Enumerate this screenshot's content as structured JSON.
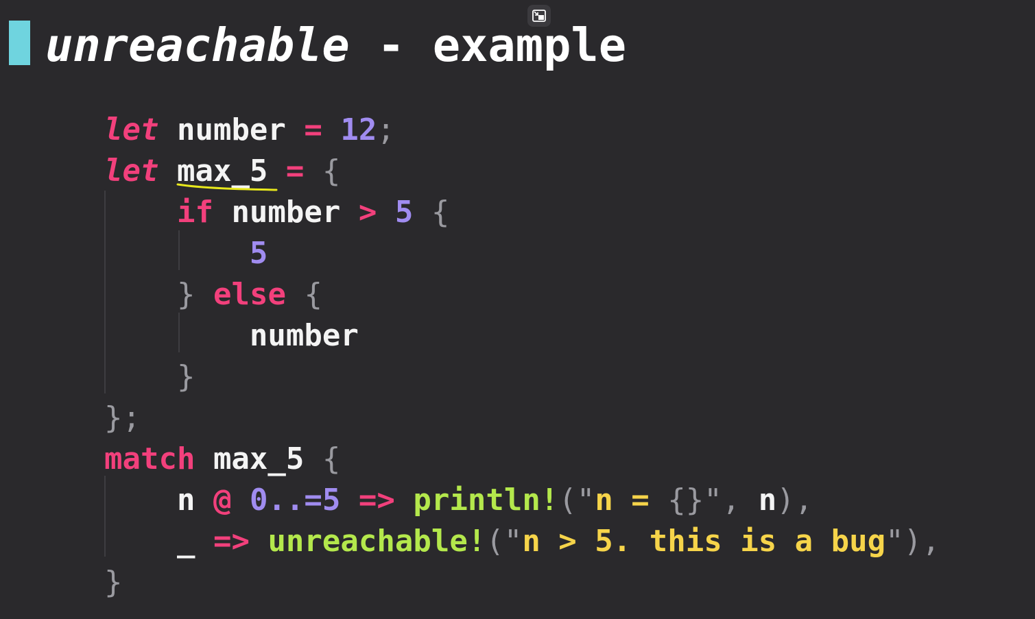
{
  "title": {
    "main": "unreachable",
    "separator": " - ",
    "rest": "example"
  },
  "code_lines": [
    [
      {
        "t": "let",
        "c": "kw-it"
      },
      {
        "t": " number ",
        "c": "ident"
      },
      {
        "t": "=",
        "c": "op"
      },
      {
        "t": " ",
        "c": "ident"
      },
      {
        "t": "12",
        "c": "num"
      },
      {
        "t": ";",
        "c": "punc"
      }
    ],
    [
      {
        "t": "let",
        "c": "kw-it"
      },
      {
        "t": " max_5 ",
        "c": "ident"
      },
      {
        "t": "=",
        "c": "op"
      },
      {
        "t": " ",
        "c": "ident"
      },
      {
        "t": "{",
        "c": "punc"
      }
    ],
    [
      {
        "t": "    ",
        "c": "ident"
      },
      {
        "t": "if",
        "c": "kw"
      },
      {
        "t": " number ",
        "c": "ident"
      },
      {
        "t": ">",
        "c": "op"
      },
      {
        "t": " ",
        "c": "ident"
      },
      {
        "t": "5",
        "c": "num"
      },
      {
        "t": " ",
        "c": "ident"
      },
      {
        "t": "{",
        "c": "punc"
      }
    ],
    [
      {
        "t": "        ",
        "c": "ident"
      },
      {
        "t": "5",
        "c": "num"
      }
    ],
    [
      {
        "t": "    ",
        "c": "ident"
      },
      {
        "t": "}",
        "c": "punc"
      },
      {
        "t": " ",
        "c": "ident"
      },
      {
        "t": "else",
        "c": "kw"
      },
      {
        "t": " ",
        "c": "ident"
      },
      {
        "t": "{",
        "c": "punc"
      }
    ],
    [
      {
        "t": "        number",
        "c": "ident"
      }
    ],
    [
      {
        "t": "    ",
        "c": "ident"
      },
      {
        "t": "}",
        "c": "punc"
      }
    ],
    [
      {
        "t": "};",
        "c": "punc"
      }
    ],
    [
      {
        "t": "match",
        "c": "kw"
      },
      {
        "t": " max_5 ",
        "c": "ident"
      },
      {
        "t": "{",
        "c": "punc"
      }
    ],
    [
      {
        "t": "    n ",
        "c": "ident"
      },
      {
        "t": "@",
        "c": "op"
      },
      {
        "t": " ",
        "c": "ident"
      },
      {
        "t": "0..=",
        "c": "num"
      },
      {
        "t": "5",
        "c": "num"
      },
      {
        "t": " ",
        "c": "ident"
      },
      {
        "t": "=>",
        "c": "op"
      },
      {
        "t": " ",
        "c": "ident"
      },
      {
        "t": "println!",
        "c": "macro"
      },
      {
        "t": "(",
        "c": "punc"
      },
      {
        "t": "\"",
        "c": "punc"
      },
      {
        "t": "n = ",
        "c": "str"
      },
      {
        "t": "{}",
        "c": "punc"
      },
      {
        "t": "\"",
        "c": "punc"
      },
      {
        "t": ",",
        "c": "punc"
      },
      {
        "t": " n",
        "c": "ident"
      },
      {
        "t": "),",
        "c": "punc"
      }
    ],
    [
      {
        "t": "    _ ",
        "c": "ident"
      },
      {
        "t": "=>",
        "c": "op"
      },
      {
        "t": " ",
        "c": "ident"
      },
      {
        "t": "unreachable!",
        "c": "macro"
      },
      {
        "t": "(",
        "c": "punc"
      },
      {
        "t": "\"",
        "c": "punc"
      },
      {
        "t": "n > 5. this is a bug",
        "c": "str"
      },
      {
        "t": "\"",
        "c": "punc"
      },
      {
        "t": "),",
        "c": "punc"
      }
    ],
    [
      {
        "t": "}",
        "c": "punc"
      }
    ]
  ],
  "colors": {
    "background": "#2a292c",
    "keyword": "#f2407c",
    "number": "#a08cf0",
    "macro": "#b4e84c",
    "string": "#f6d44a",
    "title_accent": "#6fd4df",
    "annotation_underline": "#e8e81c"
  },
  "icons": {
    "exit_pip": "exit-picture-in-picture-icon"
  }
}
